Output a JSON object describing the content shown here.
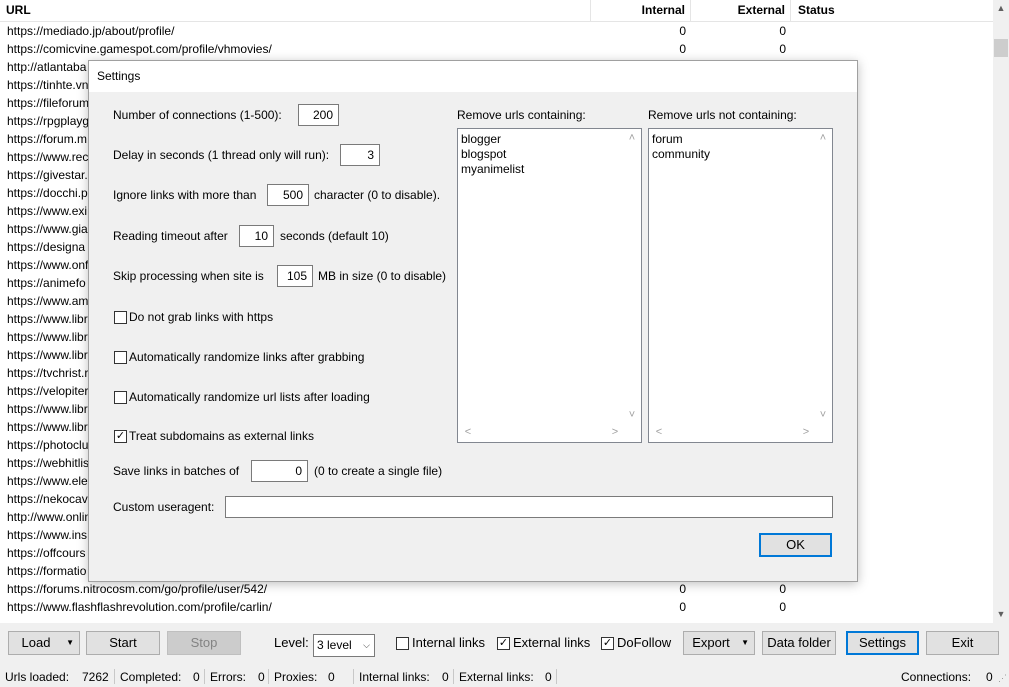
{
  "grid": {
    "headers": {
      "url": "URL",
      "internal": "Internal",
      "external": "External",
      "status": "Status"
    },
    "rows": [
      {
        "url": "https://mediado.jp/about/profile/",
        "internal": "0",
        "external": "0"
      },
      {
        "url": "https://comicvine.gamespot.com/profile/vhmovies/",
        "internal": "0",
        "external": "0"
      },
      {
        "url": "http://atlantaba",
        "internal": "",
        "external": ""
      },
      {
        "url": "https://tinhte.vn",
        "internal": "",
        "external": ""
      },
      {
        "url": "https://fileforum",
        "internal": "",
        "external": ""
      },
      {
        "url": "https://rpgplayg",
        "internal": "",
        "external": ""
      },
      {
        "url": "https://forum.m",
        "internal": "",
        "external": ""
      },
      {
        "url": "https://www.rec",
        "internal": "",
        "external": ""
      },
      {
        "url": "https://givestar.",
        "internal": "",
        "external": ""
      },
      {
        "url": "https://docchi.p",
        "internal": "",
        "external": ""
      },
      {
        "url": "https://www.exi",
        "internal": "",
        "external": ""
      },
      {
        "url": "https://www.gia",
        "internal": "",
        "external": ""
      },
      {
        "url": "https://designa",
        "internal": "",
        "external": ""
      },
      {
        "url": "https://www.onf",
        "internal": "",
        "external": ""
      },
      {
        "url": "https://animefo",
        "internal": "",
        "external": ""
      },
      {
        "url": "https://www.am",
        "internal": "",
        "external": ""
      },
      {
        "url": "https://www.libr",
        "internal": "",
        "external": ""
      },
      {
        "url": "https://www.libr",
        "internal": "",
        "external": ""
      },
      {
        "url": "https://www.libr",
        "internal": "",
        "external": ""
      },
      {
        "url": "https://tvchrist.r",
        "internal": "",
        "external": ""
      },
      {
        "url": "https://velopiter",
        "internal": "",
        "external": ""
      },
      {
        "url": "https://www.libr",
        "internal": "",
        "external": ""
      },
      {
        "url": "https://www.libr",
        "internal": "",
        "external": ""
      },
      {
        "url": "https://photoclu",
        "internal": "",
        "external": ""
      },
      {
        "url": "https://webhitlis",
        "internal": "",
        "external": ""
      },
      {
        "url": "https://www.ele",
        "internal": "",
        "external": ""
      },
      {
        "url": "https://nekocav",
        "internal": "",
        "external": ""
      },
      {
        "url": "http://www.onlin",
        "internal": "",
        "external": ""
      },
      {
        "url": "https://www.ins",
        "internal": "",
        "external": ""
      },
      {
        "url": "https://offcours",
        "internal": "",
        "external": ""
      },
      {
        "url": "https://formatio",
        "internal": "",
        "external": ""
      },
      {
        "url": "https://forums.nitrocosm.com/go/profile/user/542/",
        "internal": "0",
        "external": "0"
      },
      {
        "url": "https://www.flashflashrevolution.com/profile/carlin/",
        "internal": "0",
        "external": "0"
      }
    ]
  },
  "dialog": {
    "title": "Settings",
    "connections_label": "Number of connections (1-500):",
    "connections_value": "200",
    "delay_label": "Delay in seconds (1 thread only will run):",
    "delay_value": "3",
    "ignore_label": "Ignore links with more than",
    "ignore_value": "500",
    "ignore_suffix": "character (0 to disable).",
    "timeout_label": "Reading timeout after",
    "timeout_value": "10",
    "timeout_suffix": "seconds (default 10)",
    "skip_label": "Skip processing when site is",
    "skip_value": "105",
    "skip_suffix": "MB in size (0 to disable)",
    "chk_https": {
      "label": "Do not grab links with https",
      "checked": false
    },
    "chk_randomize_links": {
      "label": "Automatically randomize links after grabbing",
      "checked": false
    },
    "chk_randomize_lists": {
      "label": "Automatically randomize url lists after loading",
      "checked": false
    },
    "chk_subdomains": {
      "label": "Treat subdomains as external links",
      "checked": true
    },
    "batch_label": "Save links in batches of",
    "batch_value": "0",
    "batch_suffix": "(0 to create a single file)",
    "useragent_label": "Custom useragent:",
    "useragent_value": "",
    "remove_containing_label": "Remove urls containing:",
    "remove_containing": [
      "blogger",
      "blogspot",
      "myanimelist"
    ],
    "remove_not_containing_label": "Remove urls not containing:",
    "remove_not_containing": [
      "forum",
      "community"
    ],
    "ok_label": "OK"
  },
  "toolbar": {
    "load": "Load",
    "start": "Start",
    "stop": "Stop",
    "level_label": "Level:",
    "level_value": "3 level",
    "internal_links": {
      "label": "Internal links",
      "checked": false
    },
    "external_links": {
      "label": "External links",
      "checked": true
    },
    "dofollow": {
      "label": "DoFollow",
      "checked": true
    },
    "export": "Export",
    "data_folder": "Data folder",
    "settings": "Settings",
    "exit": "Exit"
  },
  "status": {
    "urls_loaded_label": "Urls loaded:",
    "urls_loaded": "7262",
    "completed_label": "Completed:",
    "completed": "0",
    "errors_label": "Errors:",
    "errors": "0",
    "proxies_label": "Proxies:",
    "proxies": "0",
    "internal_links_label": "Internal links:",
    "internal_links": "0",
    "external_links_label": "External links:",
    "external_links": "0",
    "connections_label": "Connections:",
    "connections": "0"
  }
}
